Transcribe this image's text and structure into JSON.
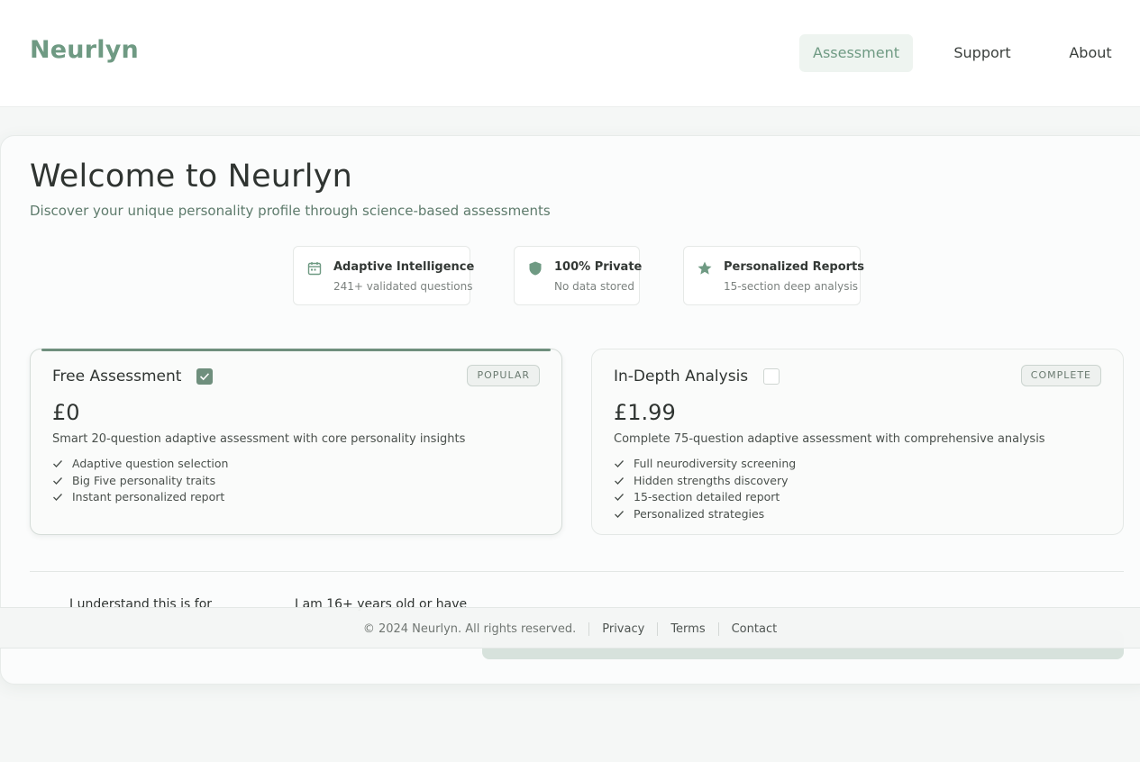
{
  "brand": {
    "logo": "Neurlyn",
    "accent": "#6f9a83"
  },
  "nav": {
    "items": [
      {
        "label": "Assessment",
        "active": true
      },
      {
        "label": "Support",
        "active": false
      },
      {
        "label": "About",
        "active": false
      }
    ]
  },
  "hero": {
    "title": "Welcome to Neurlyn",
    "subtitle": "Discover your unique personality profile through science-based assessments"
  },
  "features": [
    {
      "icon": "calendar-icon",
      "title": "Adaptive Intelligence",
      "subtitle": "241+ validated questions"
    },
    {
      "icon": "shield-icon",
      "title": "100% Private",
      "subtitle": "No data stored"
    },
    {
      "icon": "star-icon",
      "title": "Personalized Reports",
      "subtitle": "15-section deep analysis"
    }
  ],
  "plans": [
    {
      "name": "Free Assessment",
      "selected": true,
      "badge": "POPULAR",
      "price": "£0",
      "description": "Smart 20-question adaptive assessment with core personality insights",
      "features": [
        "Adaptive question selection",
        "Big Five personality traits",
        "Instant personalized report"
      ]
    },
    {
      "name": "In-Depth Analysis",
      "selected": false,
      "badge": "COMPLETE",
      "price": "£1.99",
      "description": "Complete 75-question adaptive assessment with comprehensive analysis",
      "features": [
        "Full neurodiversity screening",
        "Hidden strengths discovery",
        "15-section detailed report",
        "Personalized strategies"
      ]
    }
  ],
  "consent": {
    "item1": "I understand this is for",
    "item2": "I am 16+ years old or have"
  },
  "footer": {
    "copyright": "© 2024 Neurlyn. All rights reserved.",
    "links": [
      "Privacy",
      "Terms",
      "Contact"
    ]
  }
}
